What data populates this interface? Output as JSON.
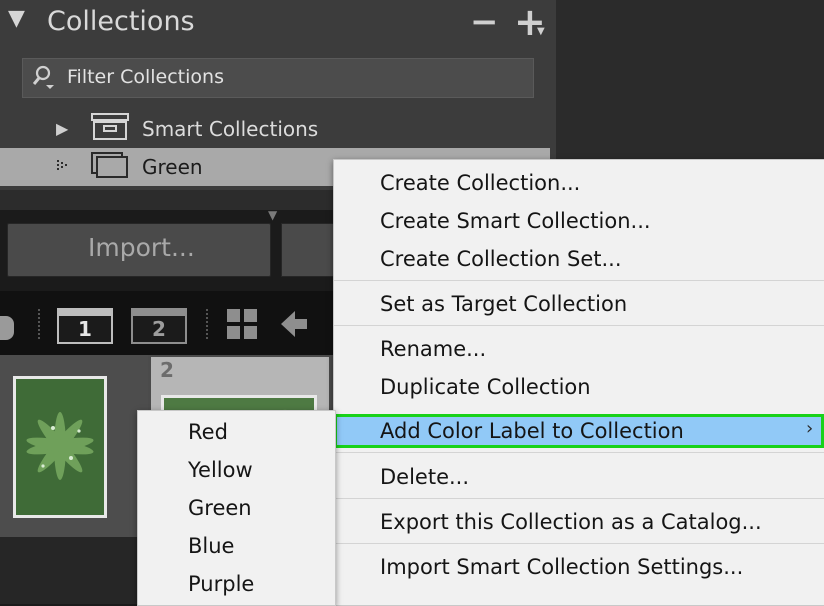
{
  "collections_panel": {
    "title": "Collections",
    "minus_label": "−",
    "plus_label": "+",
    "filter_placeholder": "Filter Collections",
    "items": [
      {
        "label": "Smart Collections",
        "type": "collection-set",
        "expanded": false
      },
      {
        "label": "Green",
        "type": "collection",
        "selected": true
      }
    ]
  },
  "import_button": {
    "label": "Import..."
  },
  "toolbar": {
    "window_1": "1",
    "window_2": "2"
  },
  "filmstrip": {
    "cells": [
      {
        "number": ""
      },
      {
        "number": "2"
      }
    ]
  },
  "context_menu": {
    "items": [
      "Create Collection...",
      "Create Smart Collection...",
      "Create Collection Set...",
      "Set as Target Collection",
      "Rename...",
      "Duplicate Collection",
      "Add Color Label to Collection",
      "Delete...",
      "Export this Collection as a Catalog...",
      "Import Smart Collection Settings..."
    ],
    "highlighted": "Add Color Label to Collection"
  },
  "submenu": {
    "items": [
      "Red",
      "Yellow",
      "Green",
      "Blue",
      "Purple"
    ]
  },
  "colors": {
    "menu_highlight": "#91c9f7",
    "highlight_outline": "#19d219",
    "selected_row": "#a9a9a9"
  }
}
